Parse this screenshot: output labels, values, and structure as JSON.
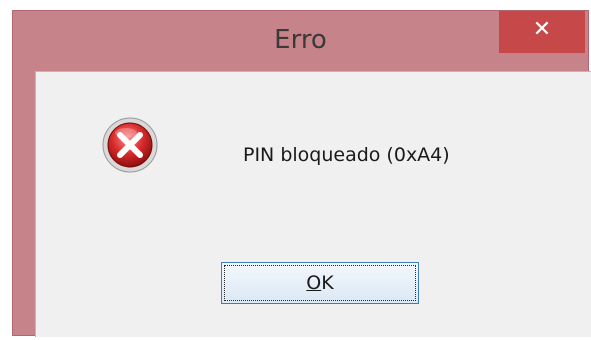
{
  "dialog": {
    "title": "Erro",
    "close_label": "✕",
    "message": "PIN bloqueado (0xA4)",
    "icon": "error-icon",
    "ok_button": {
      "label_mnemonic": "O",
      "label_rest": "K"
    }
  },
  "colors": {
    "frame": "#c7838a",
    "close_button": "#c74848",
    "content_bg": "#f0f0f0",
    "focus_border": "#3c7fb1",
    "error_red": "#d62a2a"
  }
}
